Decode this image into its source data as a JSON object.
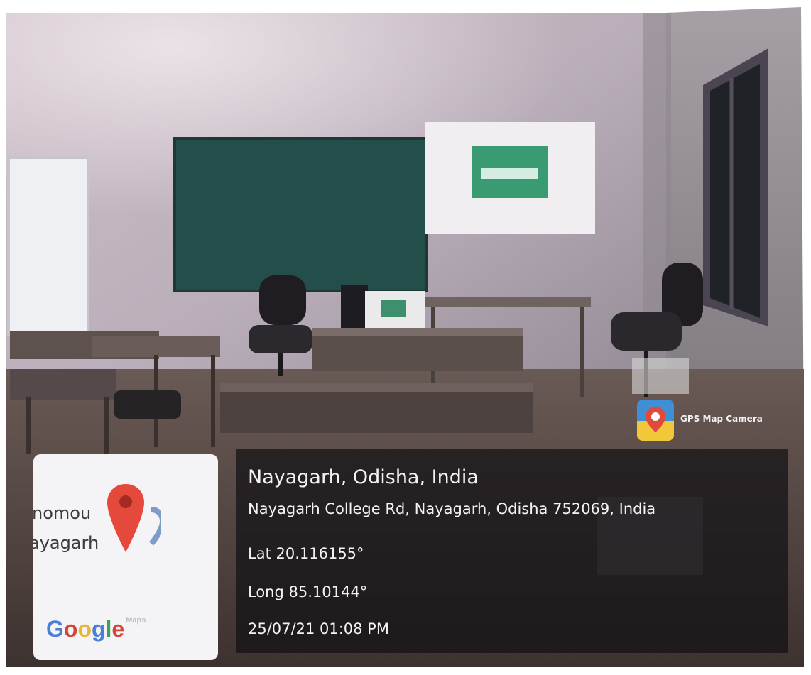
{
  "overlay": {
    "app_name": "GPS Map Camera",
    "place": "Nayagarh, Odisha, India",
    "address": "Nayagarh College Rd, Nayagarh, Odisha 752069, India",
    "latitude": "Lat 20.116155°",
    "longitude": "Long 85.10144°",
    "datetime": "25/07/21 01:08 PM"
  },
  "map_card": {
    "line1": "nomou",
    "line2": "ayagarh",
    "brand_letters": [
      "G",
      "o",
      "o",
      "g",
      "l",
      "e"
    ],
    "brand_suffix": "Maps",
    "brand_colors": [
      "#4a7fd8",
      "#d6453a",
      "#e8b630",
      "#4a7fd8",
      "#3aa35a",
      "#d6453a"
    ]
  },
  "scene": {
    "description_icons": [
      "chair-icon",
      "monitor-icon",
      "map-pin-icon",
      "app-icon"
    ]
  }
}
